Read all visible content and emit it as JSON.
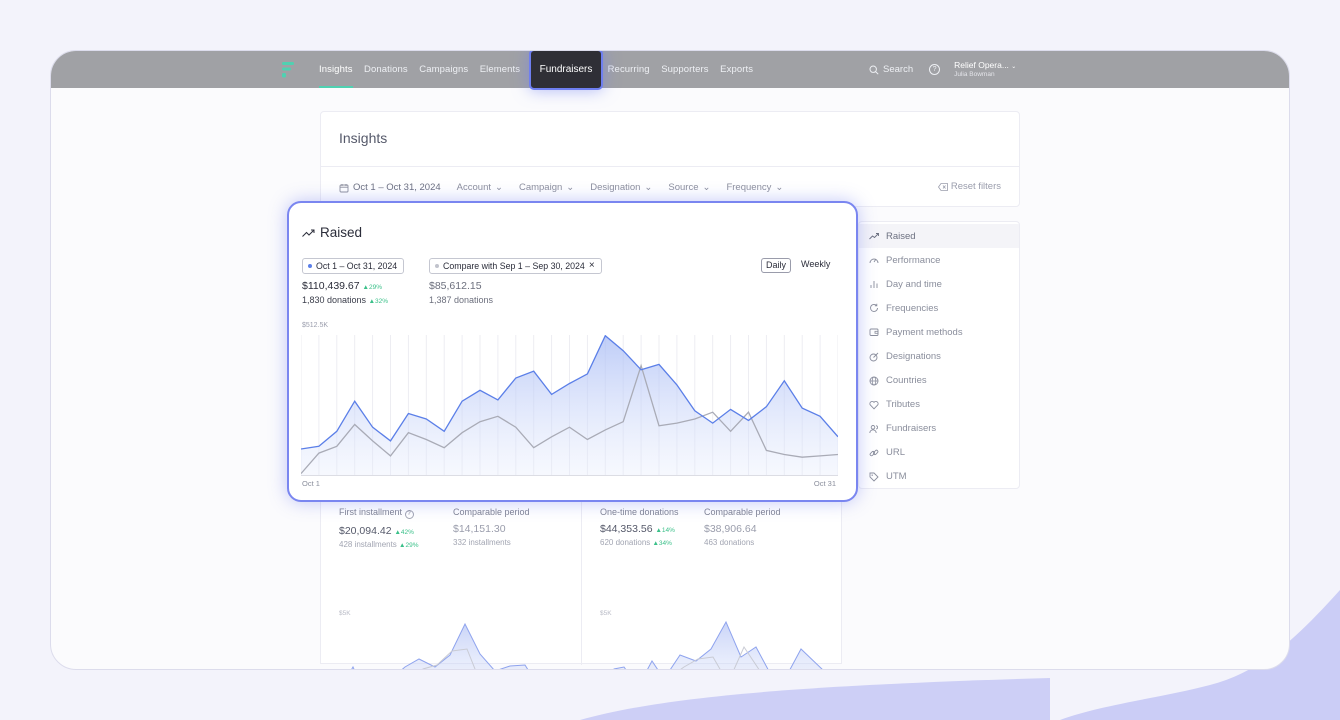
{
  "nav": {
    "items": [
      "Insights",
      "Donations",
      "Campaigns",
      "Elements",
      "Fundraisers",
      "Recurring",
      "Supporters",
      "Exports"
    ],
    "active": "Insights",
    "highlighted": "Fundraisers",
    "search_label": "Search",
    "help_label": "?",
    "account_name": "Relief Opera...",
    "account_user": "Julia Bowman"
  },
  "insights": {
    "title": "Insights",
    "date_range": "Oct 1 – Oct 31, 2024",
    "filters": [
      "Account",
      "Campaign",
      "Designation",
      "Source",
      "Frequency"
    ],
    "reset_label": "Reset filters"
  },
  "sidebar": {
    "items": [
      {
        "label": "Raised",
        "icon": "trend-icon"
      },
      {
        "label": "Performance",
        "icon": "gauge-icon"
      },
      {
        "label": "Day and time",
        "icon": "bars-icon"
      },
      {
        "label": "Frequencies",
        "icon": "refresh-icon"
      },
      {
        "label": "Payment methods",
        "icon": "wallet-icon"
      },
      {
        "label": "Designations",
        "icon": "target-icon"
      },
      {
        "label": "Countries",
        "icon": "globe-icon"
      },
      {
        "label": "Tributes",
        "icon": "heart-icon"
      },
      {
        "label": "Fundraisers",
        "icon": "users-icon"
      },
      {
        "label": "URL",
        "icon": "link-icon"
      },
      {
        "label": "UTM",
        "icon": "tag-icon"
      }
    ],
    "active": "Raised"
  },
  "raised": {
    "title": "Raised",
    "period_chip": "Oct 1 – Oct 31, 2024",
    "compare_chip": "Compare with Sep 1 – Sep 30, 2024",
    "compare_close": "×",
    "toggle": [
      "Daily",
      "Weekly"
    ],
    "toggle_selected": "Daily",
    "current_total": "$110,439.67",
    "current_total_change": "▲29%",
    "current_donations": "1,830 donations",
    "current_donations_change": "▲32%",
    "compare_total": "$85,612.15",
    "compare_donations": "1,387 donations",
    "y_max_label": "$512.5K",
    "x_start_label": "Oct 1",
    "x_end_label": "Oct 31",
    "colors": {
      "current": "#5b7fe8",
      "compare": "#a9abb6"
    }
  },
  "chart_data": {
    "type": "area",
    "x": [
      1,
      2,
      3,
      4,
      5,
      6,
      7,
      8,
      9,
      10,
      11,
      12,
      13,
      14,
      15,
      16,
      17,
      18,
      19,
      20,
      21,
      22,
      23,
      24,
      25,
      26,
      27,
      28,
      29,
      30,
      31
    ],
    "ylim": [
      0,
      512.5
    ],
    "series": [
      {
        "values": [
          95,
          105,
          160,
          270,
          175,
          125,
          225,
          205,
          160,
          270,
          310,
          275,
          355,
          380,
          295,
          335,
          370,
          510,
          455,
          385,
          405,
          330,
          235,
          190,
          240,
          200,
          250,
          345,
          245,
          215,
          140
        ]
      },
      {
        "values": [
          5,
          80,
          105,
          185,
          125,
          70,
          155,
          130,
          100,
          155,
          195,
          215,
          175,
          100,
          140,
          175,
          130,
          165,
          195,
          400,
          180,
          190,
          205,
          230,
          160,
          230,
          90,
          75,
          65,
          70,
          75
        ]
      }
    ]
  },
  "installments": {
    "label": "First installment",
    "value": "$20,094.42",
    "value_change": "▲42%",
    "count": "428 installments",
    "count_change": "▲29%",
    "compare_label": "Comparable period",
    "compare_value": "$14,151.30",
    "compare_count": "332 installments",
    "axis_label": "$5K"
  },
  "one_time": {
    "label": "One-time donations",
    "value": "$44,353.56",
    "value_change": "▲14%",
    "count": "620 donations",
    "count_change": "▲34%",
    "compare_label": "Comparable period",
    "compare_value": "$38,906.64",
    "compare_count": "463 donations",
    "axis_label": "$5K"
  }
}
